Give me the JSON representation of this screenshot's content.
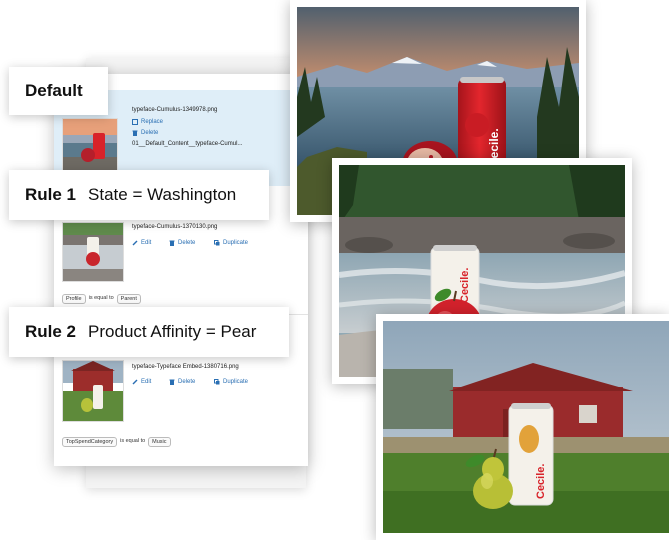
{
  "labels": {
    "default": "Default",
    "rule1_name": "Rule 1",
    "rule1_cond": "State = Washington",
    "rule2_name": "Rule 2",
    "rule2_cond": "Product Affinity = Pear"
  },
  "panel": {
    "default_item": {
      "filename": "typeface-Cumulus-1349978.png",
      "replace": "Replace",
      "delete": "Delete",
      "content": "01__Default_Content__typeface-Cumul..."
    },
    "rule1_item": {
      "filename": "typeface-Cumulus-1370130.png",
      "edit": "Edit",
      "delete": "Delete",
      "duplicate": "Duplicate",
      "cond_field": "Profile",
      "cond_op": "is equal to",
      "cond_value": "Parent"
    },
    "rule2_item": {
      "filename": "typeface-Typeface Embed-1380716.png",
      "edit": "Edit",
      "delete": "Delete",
      "duplicate": "Duplicate",
      "cond_field": "TopSpendCategory",
      "cond_op": "is equal to",
      "cond_value": "Music"
    }
  },
  "brand": {
    "can_text": "Cecile.",
    "can_red": "#d8232a",
    "link_blue": "#2a6fb3"
  }
}
